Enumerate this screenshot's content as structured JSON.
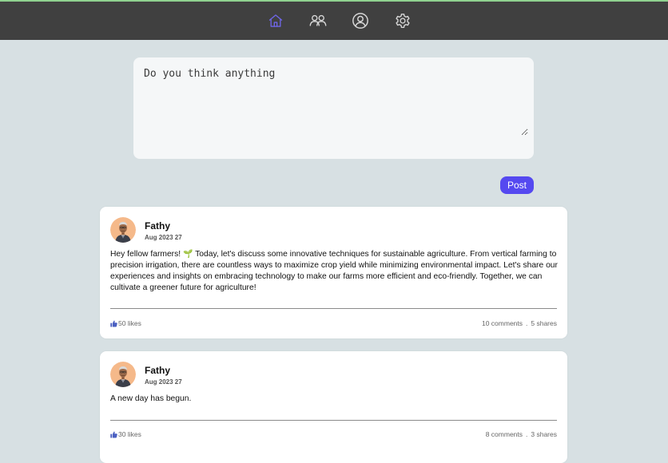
{
  "nav": {
    "items": [
      {
        "icon": "home-icon",
        "active": true
      },
      {
        "icon": "friends-icon",
        "active": false
      },
      {
        "icon": "profile-icon",
        "active": false
      },
      {
        "icon": "settings-icon",
        "active": false
      }
    ],
    "active_color": "#6f66e8",
    "icon_color": "#d8d8d8"
  },
  "composer": {
    "placeholder": "Do you think anything",
    "post_label": "Post"
  },
  "posts": [
    {
      "author": "Fathy",
      "date": "Aug 2023 27",
      "text_before": "Hey fellow farmers!",
      "emoji": "🌱",
      "text_after": "Today, let's discuss some innovative techniques for sustainable agriculture. From vertical farming to precision irrigation, there are countless ways to maximize crop yield while minimizing environmental impact. Let's share our experiences and insights on embracing technology to make our farms more efficient and eco-friendly. Together, we can cultivate a greener future for agriculture!",
      "likes": "50 likes",
      "comments": "10 comments",
      "separator": ".",
      "shares": "5 shares"
    },
    {
      "author": "Fathy",
      "date": "Aug 2023 27",
      "text_before": "A new day has begun.",
      "likes": "30 likes",
      "comments": "8 comments",
      "separator": ".",
      "shares": "3 shares"
    }
  ],
  "colors": {
    "background": "#d7e0e3",
    "topbar": "#404040",
    "accent": "#5549f0",
    "like_icon": "#4a5fc1"
  }
}
